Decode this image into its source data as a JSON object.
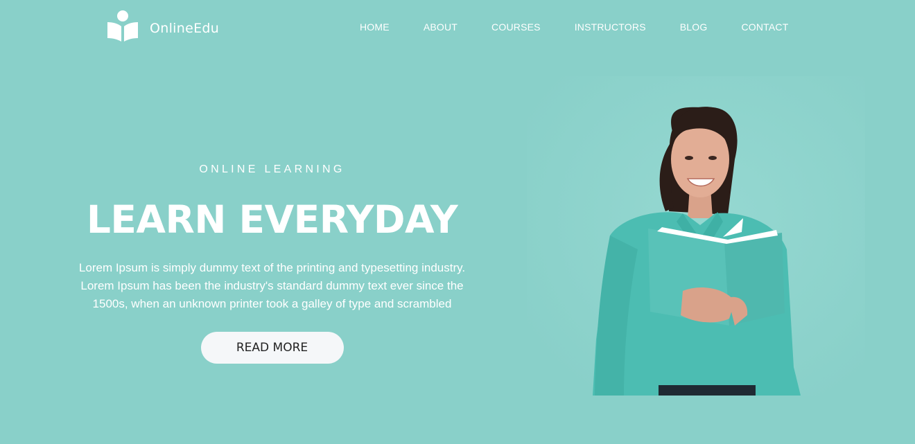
{
  "brand": {
    "name": "OnlineEdu",
    "logo_icon": "book-reader-icon"
  },
  "nav": {
    "items": [
      {
        "label": "HOME"
      },
      {
        "label": "ABOUT"
      },
      {
        "label": "COURSES"
      },
      {
        "label": "INSTRUCTORS"
      },
      {
        "label": "BLOG"
      },
      {
        "label": "CONTACT"
      }
    ]
  },
  "hero": {
    "eyebrow": "ONLINE LEARNING",
    "headline": "LEARN EVERYDAY",
    "description_lines": [
      "Lorem Ipsum is simply dummy text of the printing and typesetting industry.",
      "Lorem Ipsum has been the industry's standard dummy text ever since the",
      "1500s, when an unknown printer took a galley of type and scrambled"
    ],
    "cta_label": "READ MORE",
    "image_subject": "woman-reading-book"
  },
  "colors": {
    "background": "#89d0c9",
    "text": "#ffffff",
    "button_bg": "#f5f7f9",
    "button_text": "#222222"
  }
}
